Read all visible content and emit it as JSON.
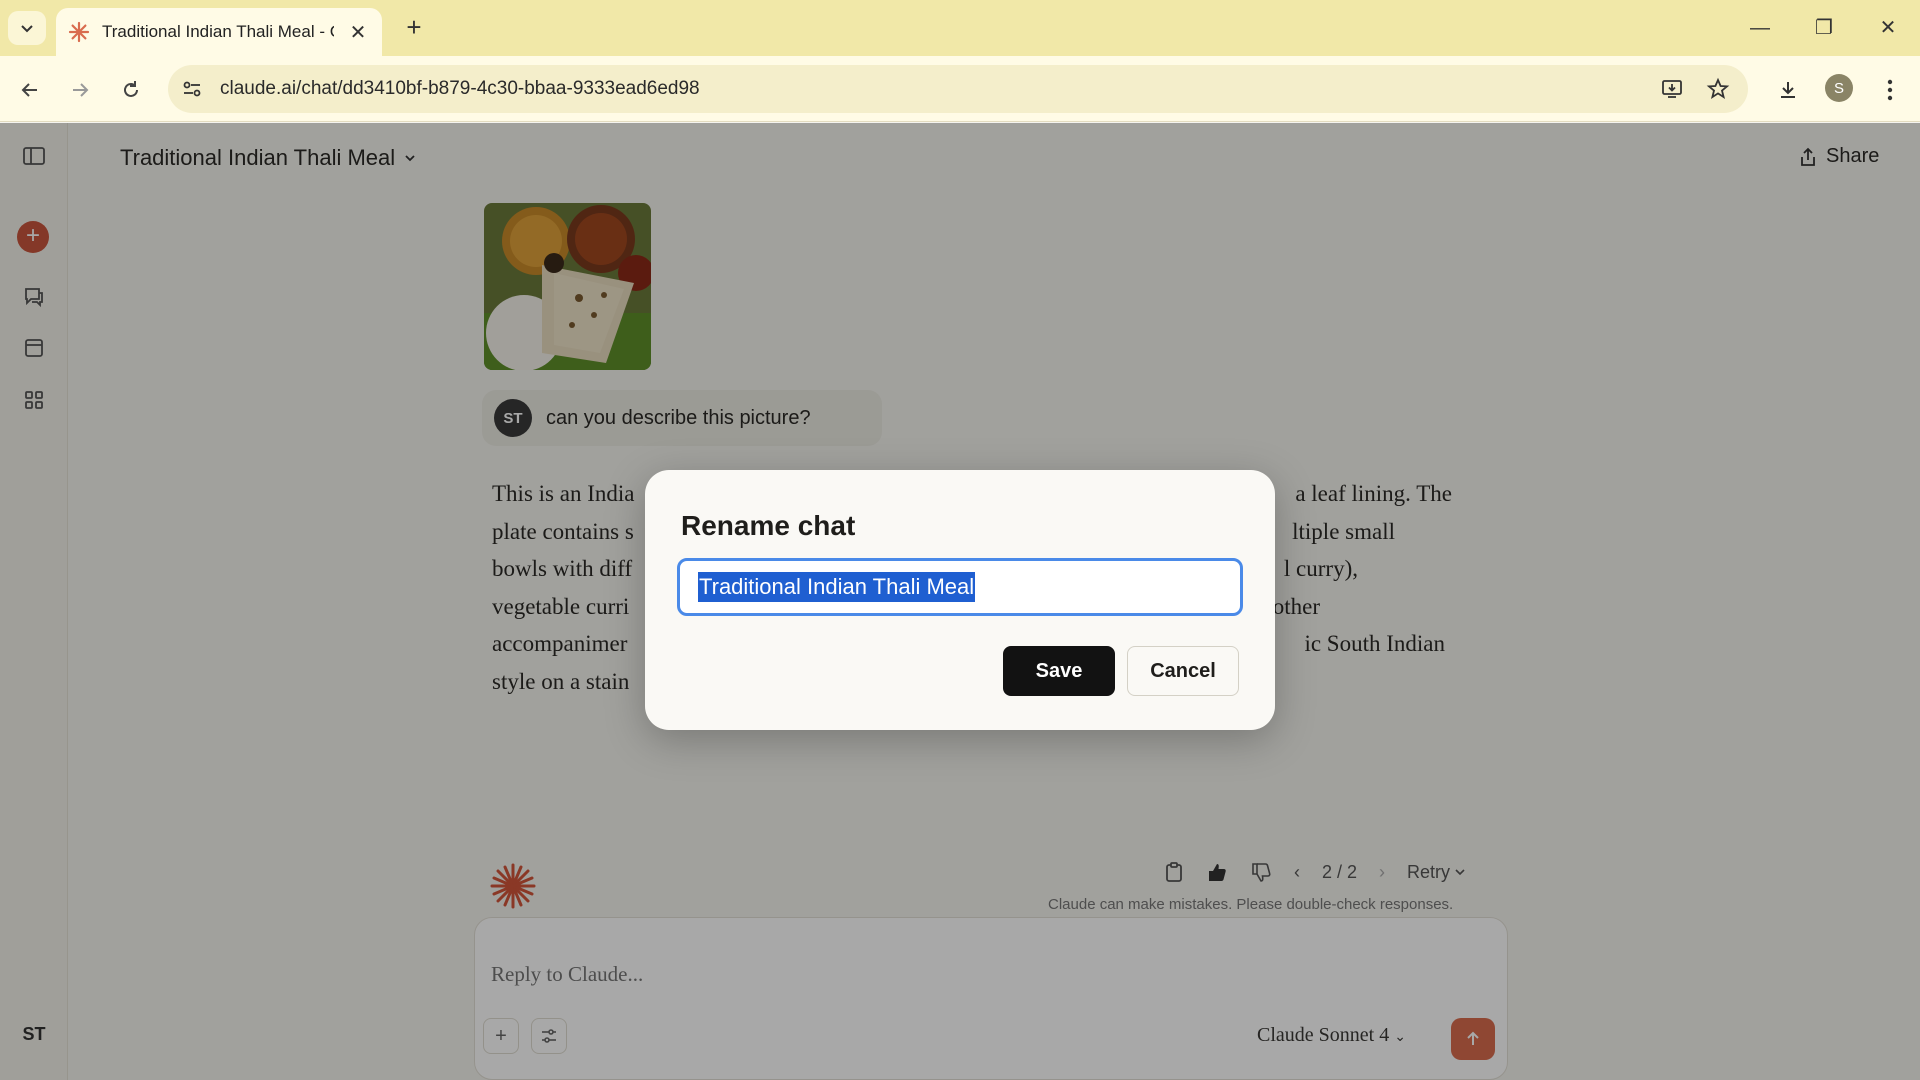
{
  "browser": {
    "tab_title": "Traditional Indian Thali Meal - C",
    "url": "claude.ai/chat/dd3410bf-b879-4c30-bbaa-9333ead6ed98",
    "profile_initial": "S"
  },
  "header": {
    "chat_title": "Traditional Indian Thali Meal",
    "share_label": "Share"
  },
  "sidebar": {
    "user_initials": "ST"
  },
  "conversation": {
    "user_initials": "ST",
    "user_message": "can you describe this picture?",
    "reply_lines": [
      "This is an India",
      "plate contains s",
      "bowls with diff",
      "vegetable curri",
      "accompanimer",
      "style on a stain"
    ],
    "reply_lines_right": [
      "a leaf lining. The",
      "ltiple small",
      "l curry),",
      "l other",
      "ic South Indian",
      ""
    ],
    "version_counter": "2 / 2",
    "retry_label": "Retry",
    "disclaimer": "Claude can make mistakes. Please double-check responses."
  },
  "composer": {
    "placeholder": "Reply to Claude...",
    "model": "Claude Sonnet 4"
  },
  "modal": {
    "title": "Rename chat",
    "input_value": "Traditional Indian Thali Meal",
    "save_label": "Save",
    "cancel_label": "Cancel"
  }
}
